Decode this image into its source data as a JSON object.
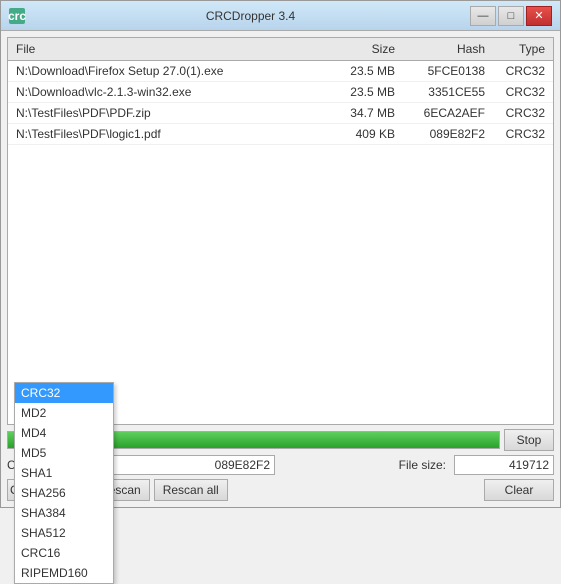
{
  "window": {
    "title": "CRCDropper 3.4",
    "icon_label": "crc"
  },
  "title_buttons": {
    "minimize": "—",
    "maximize": "□",
    "close": "✕"
  },
  "table": {
    "headers": [
      {
        "label": "File",
        "align": "left"
      },
      {
        "label": "Size",
        "align": "right"
      },
      {
        "label": "Hash",
        "align": "right"
      },
      {
        "label": "Type",
        "align": "right"
      }
    ],
    "rows": [
      {
        "file": "N:\\Download\\Firefox Setup 27.0(1).exe",
        "size": "23.5 MB",
        "hash": "5FCE0138",
        "type": "CRC32"
      },
      {
        "file": "N:\\Download\\vlc-2.1.3-win32.exe",
        "size": "23.5 MB",
        "hash": "3351CE55",
        "type": "CRC32"
      },
      {
        "file": "N:\\TestFiles\\PDF\\PDF.zip",
        "size": "34.7 MB",
        "hash": "6ECA2AEF",
        "type": "CRC32"
      },
      {
        "file": "N:\\TestFiles\\PDF\\logic1.pdf",
        "size": "409 KB",
        "hash": "089E82F2",
        "type": "CRC32"
      }
    ]
  },
  "progress": {
    "percent": 100
  },
  "buttons": {
    "stop": "Stop",
    "rescan": "Rescan",
    "rescan_all": "Rescan all",
    "clear": "Clear"
  },
  "checksum": {
    "label": "Checksum:",
    "value": "089E82F2"
  },
  "filesize": {
    "label": "File size:",
    "value": "419712"
  },
  "dropdown": {
    "selected": "CRC32",
    "options": [
      "CRC32",
      "MD2",
      "MD4",
      "MD5",
      "SHA1",
      "SHA256",
      "SHA384",
      "SHA512",
      "CRC16",
      "RIPEMD160"
    ]
  },
  "watermark": "CRC"
}
